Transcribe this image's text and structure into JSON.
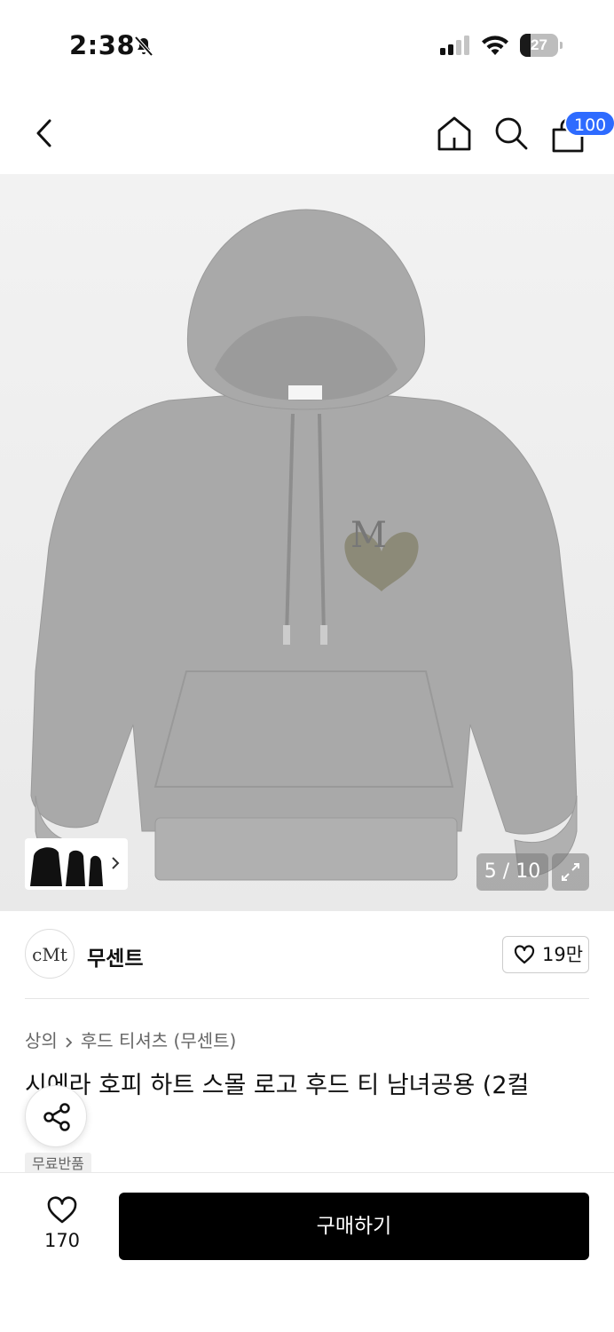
{
  "status_bar": {
    "time": "2:38",
    "battery": "27",
    "battery_level": 0.27
  },
  "nav": {
    "cart_badge": "100"
  },
  "gallery": {
    "counter": "5 / 10"
  },
  "brand": {
    "logo_text": "cMt",
    "name": "무센트",
    "like_count": "19만"
  },
  "breadcrumb": {
    "category": "상의",
    "subcategory": "후드 티셔츠 (무센트)"
  },
  "product": {
    "title": "시에라 호피 하트 스몰 로고 후드 티 남녀공용 (2컬",
    "tag": "무료반품"
  },
  "bottom_bar": {
    "wish_count": "170",
    "buy_label": "구매하기"
  },
  "icons": [
    "bell-slash-icon",
    "signal-icon",
    "wifi-icon",
    "battery-icon",
    "back-icon",
    "home-icon",
    "search-icon",
    "bag-icon",
    "chevron-right-icon",
    "expand-icon",
    "heart-icon",
    "share-icon"
  ]
}
